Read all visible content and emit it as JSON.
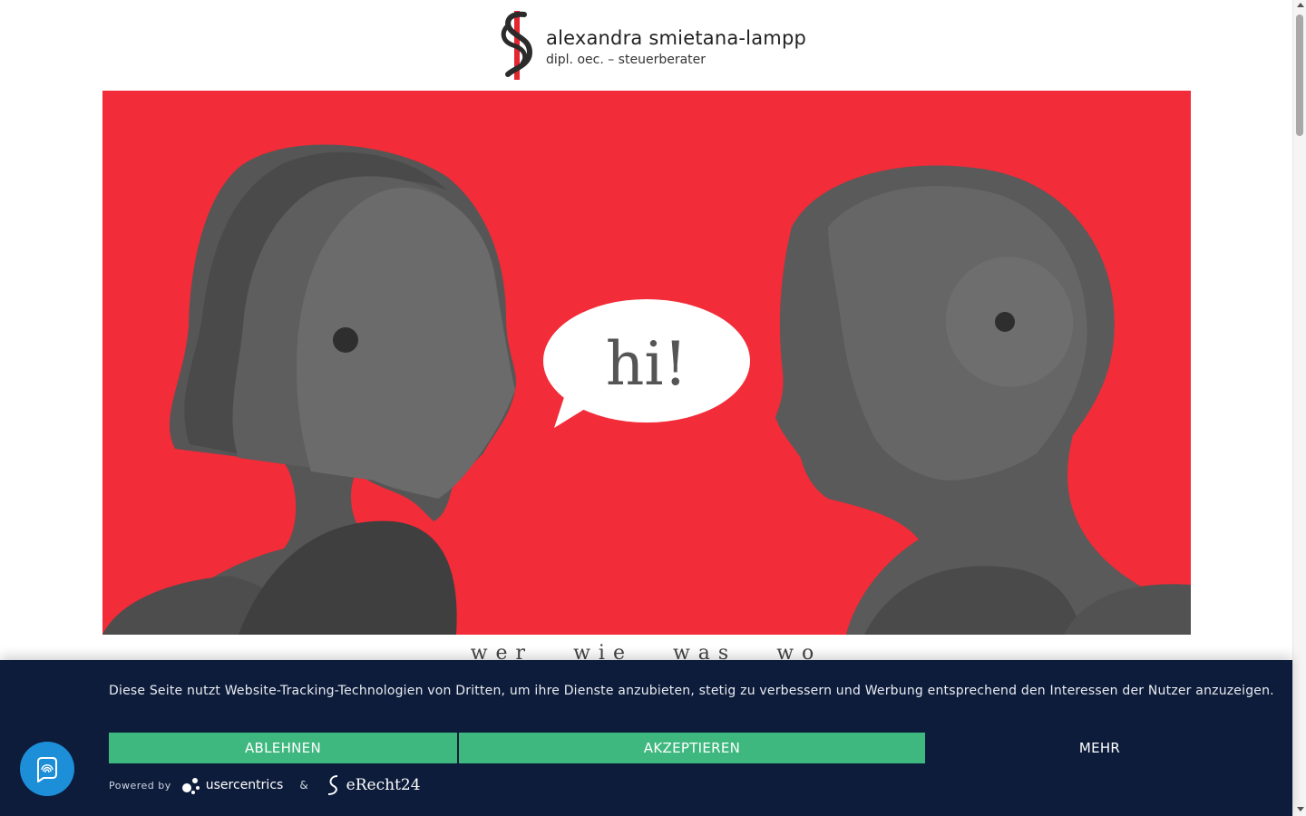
{
  "header": {
    "name": "alexandra smietana-lampp",
    "subtitle": "dipl. oec. – steuerberater",
    "colors": {
      "logo_red": "#e3262f",
      "logo_dark": "#2b2b2b"
    }
  },
  "hero": {
    "bubble_text": "hi!",
    "background_color": "#f22c38"
  },
  "nav": {
    "items": [
      "wer",
      "wie",
      "was",
      "wo"
    ]
  },
  "cookie_banner": {
    "message": "Diese Seite nutzt Website-Tracking-Technologien von Dritten, um ihre Dienste anzubieten, stetig zu verbessern und Werbung entsprechend den Interessen der Nutzer anzuzeigen.",
    "deny_label": "ABLEHNEN",
    "accept_label": "AKZEPTIEREN",
    "more_label": "MEHR",
    "powered_by": "Powered by",
    "usercentrics": "usercentrics",
    "ampersand": "&",
    "erecht": "eRecht24",
    "colors": {
      "background": "#0d1c3a",
      "button": "#3fb87f"
    }
  },
  "privacy_button": {
    "icon": "fingerprint-icon",
    "color": "#1c8fd8"
  }
}
